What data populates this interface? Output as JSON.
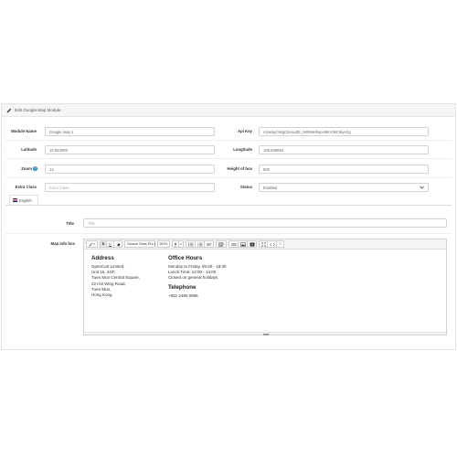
{
  "panel": {
    "title": "Edit Google Map Module"
  },
  "fields": {
    "module_name": {
      "label": "Module Name",
      "value": "Google map 1"
    },
    "api_key": {
      "label": "Api Key",
      "value": "AIzaSyC5kgCbAxuZE_iWRMHhqeH5KV3sC5lyvXg"
    },
    "latitude": {
      "label": "Latitude",
      "value": "10.823099"
    },
    "longitude": {
      "label": "Longitude",
      "value": "106.629664"
    },
    "zoom": {
      "label": "Zoom",
      "value": "14",
      "help_icon": "question-circle-icon"
    },
    "height_of_box": {
      "label": "Height of box",
      "value": "500"
    },
    "extra_class": {
      "label": "Extra Class",
      "placeholder": "Extra Class"
    },
    "status": {
      "label": "Status",
      "value": "Enabled"
    },
    "title": {
      "label": "Title",
      "placeholder": "Title"
    },
    "map_info_box": {
      "label": "Map info box"
    }
  },
  "language_tab": {
    "label": "English",
    "icon": "flag-uk-icon"
  },
  "toolbar": {
    "font_family": "Source Sans Pro",
    "font_size": "DEF",
    "font_color_letter": "A",
    "help_label": "?"
  },
  "content": {
    "address": {
      "heading": "Address",
      "lines": [
        "OpenCart Limited,",
        "Unit 16, 24/F,",
        "Tuen Mun Central Square,",
        "22 Hoi Wing Road,",
        "Tuen Mun,",
        "Hong Kong"
      ]
    },
    "office_hours": {
      "heading": "Office Hours",
      "lines": [
        "Monday to Friday, 09:30 - 18:30",
        "Lunch Time: 12:00 - 14:00",
        "Closed on general holidays"
      ]
    },
    "telephone": {
      "heading": "Telephone",
      "lines": [
        "+852 2490 0996"
      ]
    }
  },
  "colors": {
    "accent": "#1e91cf",
    "border": "#cfd4d9",
    "heading_bg": "#f5f5f5"
  }
}
